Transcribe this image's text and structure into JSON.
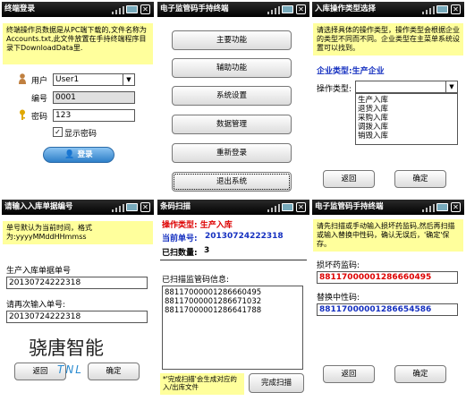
{
  "status_icons": [
    "signal-icon",
    "battery-icon",
    "close-icon"
  ],
  "close_glyph": "✕",
  "login": {
    "title": "终端登录",
    "info": "终端操作员数据是从PC端下载的,文件名称为Accounts.txt,此文件放置在手持终端程序目录下DownloadData里.",
    "user_label": "用户",
    "user_value": "User1",
    "number_label": "编号",
    "number_value": "0001",
    "password_label": "密码",
    "password_value": "123",
    "show_password_label": "显示密码",
    "show_password_checked": true,
    "login_button": "登录"
  },
  "main_menu": {
    "title": "电子监管码手持终端",
    "buttons": [
      "主要功能",
      "辅助功能",
      "系统设置",
      "数据管理",
      "重新登录",
      "退出系统"
    ]
  },
  "type_select": {
    "title": "入库操作类型选择",
    "info": "请选择具体的操作类型，操作类型会根据企业的类型不同而不同。企业类型在主菜单系统设置可以找到。",
    "enterprise_type": "企业类型:生产企业",
    "op_type_label": "操作类型:",
    "options": [
      "生产入库",
      "退货入库",
      "采购入库",
      "调拨入库",
      "销毁入库"
    ],
    "back_button": "返回",
    "ok_button": "确定"
  },
  "order_number": {
    "title": "请输入入库单据编号",
    "info": "单号默认为当前时间，格式为:yyyyMMddHHmmss",
    "order_label": "生产入库单据单号",
    "order_value": "20130724222318",
    "confirm_label": "请再次输入单号:",
    "confirm_value": "20130724222318",
    "back_button": "返回",
    "ok_button": "确定",
    "watermark_cn": "骁唐智能",
    "watermark_en": "TNL"
  },
  "scan": {
    "title": "条码扫描",
    "op_type_text": "操作类型: 生产入库",
    "current_order_label": "当前单号:",
    "current_order_value": "20130724222318",
    "scanned_count_label": "已扫数量:",
    "scanned_count_value": "3",
    "scanned_info_label": "已扫描监管码信息:",
    "codes": [
      "88117000001286660495",
      "88117000001286671032",
      "88117000001286641788"
    ],
    "note": "*'完成扫描'会生成对应的入/出库文件",
    "finish_button": "完成扫描"
  },
  "replace": {
    "title": "电子监管码手持终端",
    "info": "请先扫描或手动输入损坏药监码,然后再扫描或输入替换中性码，确认无误后，'确定'保存。",
    "damaged_label": "损坏药监码:",
    "damaged_value": "88117000001286660495",
    "replace_label": "替换中性码:",
    "replace_value": "88117000001286654586",
    "back_button": "返回",
    "ok_button": "确定"
  }
}
